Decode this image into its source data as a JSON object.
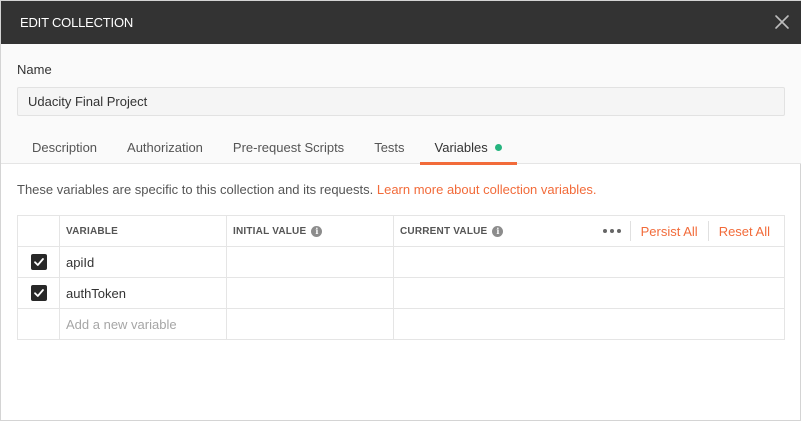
{
  "dialog": {
    "title": "EDIT COLLECTION",
    "close_icon": "close-icon"
  },
  "name": {
    "label": "Name",
    "value": "Udacity Final Project"
  },
  "tabs": [
    {
      "label": "Description",
      "active": false
    },
    {
      "label": "Authorization",
      "active": false
    },
    {
      "label": "Pre-request Scripts",
      "active": false
    },
    {
      "label": "Tests",
      "active": false
    },
    {
      "label": "Variables",
      "active": true,
      "indicator_color": "#26b47f"
    }
  ],
  "variables_info": {
    "text": "These variables are specific to this collection and its requests.",
    "link": "Learn more about collection variables."
  },
  "table": {
    "headers": {
      "variable": "VARIABLE",
      "initial_value": "INITIAL VALUE",
      "current_value": "CURRENT VALUE"
    },
    "actions": {
      "more_icon": "more-horizontal-icon",
      "persist_all": "Persist All",
      "reset_all": "Reset All"
    },
    "rows": [
      {
        "checked": true,
        "variable": "apiId",
        "initial_value": "",
        "current_value": ""
      },
      {
        "checked": true,
        "variable": "authToken",
        "initial_value": "",
        "current_value": ""
      }
    ],
    "new_row_placeholder": "Add a new variable"
  },
  "colors": {
    "accent": "#f26b3a",
    "titlebar": "#333333",
    "active_dot": "#26b47f"
  }
}
